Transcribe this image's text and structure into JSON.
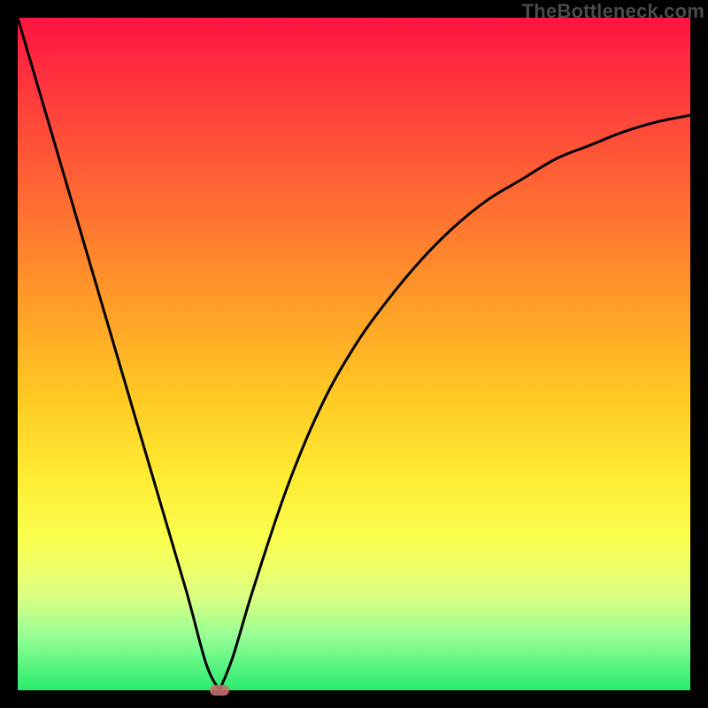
{
  "watermark": "TheBottleneck.com",
  "chart_data": {
    "type": "line",
    "title": "",
    "xlabel": "",
    "ylabel": "",
    "xlim": [
      0,
      100
    ],
    "ylim": [
      0,
      100
    ],
    "grid": false,
    "left_branch": {
      "x": [
        0,
        5,
        10,
        15,
        20,
        25,
        28,
        30
      ],
      "y": [
        100,
        83,
        66,
        49,
        32,
        15,
        4,
        0
      ]
    },
    "right_branch": {
      "x": [
        30,
        32,
        35,
        40,
        45,
        50,
        55,
        60,
        65,
        70,
        75,
        80,
        85,
        90,
        95,
        100
      ],
      "y": [
        0,
        5,
        15,
        30,
        42,
        51,
        58,
        64,
        69,
        73,
        76,
        79,
        81,
        83,
        84.5,
        85.5
      ]
    },
    "vertex": {
      "x": 30,
      "y": 0
    },
    "marker": {
      "x": 30,
      "y": 0,
      "color": "#c36e6e"
    },
    "gradient_stops": [
      {
        "pos": 0,
        "color": "#ff1441"
      },
      {
        "pos": 12,
        "color": "#ff3c3c"
      },
      {
        "pos": 28,
        "color": "#ff6e32"
      },
      {
        "pos": 42,
        "color": "#ff9b28"
      },
      {
        "pos": 56,
        "color": "#ffc823"
      },
      {
        "pos": 68,
        "color": "#ffeb32"
      },
      {
        "pos": 78,
        "color": "#faff50"
      },
      {
        "pos": 86,
        "color": "#dcff82"
      },
      {
        "pos": 92,
        "color": "#96ff96"
      },
      {
        "pos": 100,
        "color": "#28eb6e"
      }
    ]
  }
}
